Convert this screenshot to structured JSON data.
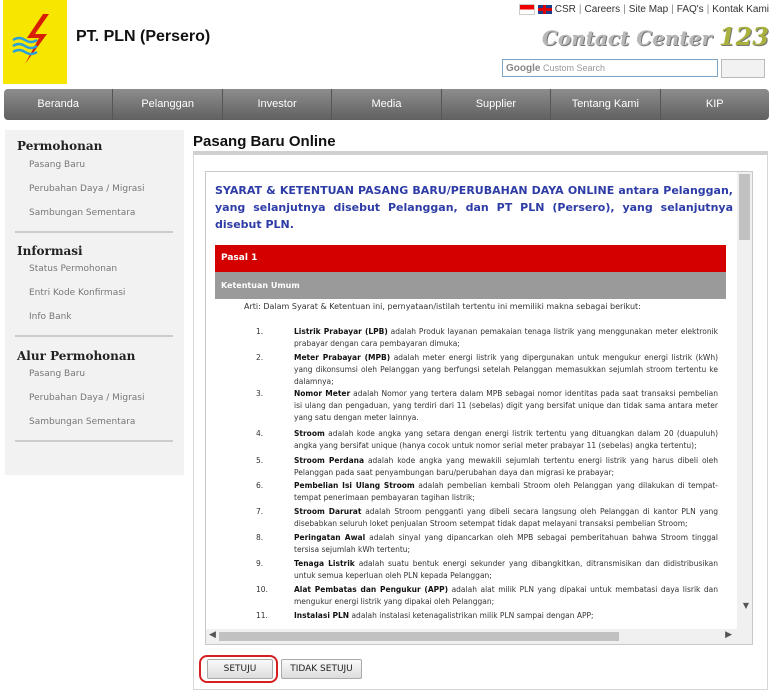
{
  "header": {
    "brand": "PT. PLN (Persero)",
    "top_links": [
      "CSR",
      "Careers",
      "Site Map",
      "FAQ's",
      "Kontak Kami"
    ],
    "contact_center_text": "Contact Center",
    "contact_center_number": "123",
    "search_google": "Google",
    "search_placeholder": "Custom Search"
  },
  "nav": [
    "Beranda",
    "Pelanggan",
    "Investor",
    "Media",
    "Supplier",
    "Tentang Kami",
    "KIP"
  ],
  "sidebar": {
    "sections": [
      {
        "title": "Permohonan",
        "items": [
          "Pasang Baru",
          "Perubahan Daya / Migrasi",
          "Sambungan Sementara"
        ]
      },
      {
        "title": "Informasi",
        "items": [
          "Status Permohonan",
          "Entri Kode Konfirmasi",
          "Info Bank"
        ]
      },
      {
        "title": "Alur Permohonan",
        "items": [
          "Pasang Baru",
          "Perubahan Daya / Migrasi",
          "Sambungan Sementara"
        ]
      }
    ]
  },
  "main": {
    "title": "Pasang Baru Online",
    "intro": "SYARAT & KETENTUAN PASANG BARU/PERUBAHAN DAYA ONLINE antara Pelanggan, yang selanjutnya disebut Pelanggan, dan PT PLN (Persero), yang selanjutnya disebut PLN.",
    "pasal": "Pasal 1",
    "section": "Ketentuan Umum",
    "arti": "Arti: Dalam Syarat & Ketentuan ini, pernyataan/istilah tertentu ini memiliki makna sebagai berikut:",
    "definitions": [
      {
        "n": "1.",
        "term": "Listrik Prabayar (LPB)",
        "text": " adalah Produk layanan pemakaian tenaga listrik yang menggunakan meter elektronik prabayar dengan cara pembayaran dimuka;"
      },
      {
        "n": "2.",
        "term": "Meter Prabayar (MPB)",
        "text": " adalah meter energi listrik yang dipergunakan untuk mengukur energi listrik (kWh) yang dikonsumsi oleh Pelanggan yang berfungsi setelah Pelanggan memasukkan sejumlah stroom tertentu ke dalamnya;"
      },
      {
        "n": "3.",
        "term": "Nomor Meter",
        "text": " adalah Nomor yang tertera dalam MPB sebagai nomor identitas pada saat transaksi pembelian isi ulang dan pengaduan, yang terdiri dari 11 (sebelas) digit yang bersifat unique dan tidak sama antara meter yang satu dengan meter lainnya."
      },
      {
        "n": "4.",
        "term": "Stroom",
        "text": " adalah kode angka yang setara dengan energi listrik tertentu yang dituangkan dalam 20 (duapuluh) angka yang bersifat unique (hanya cocok untuk nomor serial meter prabayar 11 (sebelas) angka tertentu);"
      },
      {
        "n": "5.",
        "term": "Stroom Perdana",
        "text": " adalah kode angka yang mewakili sejumlah tertentu energi listrik yang harus dibeli oleh Pelanggan pada saat penyambungan baru/perubahan daya dan migrasi ke prabayar;"
      },
      {
        "n": "6.",
        "term": "Pembelian Isi Ulang Stroom",
        "text": " adalah pembelian kembali Stroom oleh Pelanggan yang dilakukan di tempat-tempat penerimaan pembayaran tagihan listrik;"
      },
      {
        "n": "7.",
        "term": "Stroom Darurat",
        "text": " adalah Stroom pengganti yang dibeli secara langsung oleh Pelanggan di kantor PLN yang disebabkan seluruh loket penjualan Stroom setempat tidak dapat melayani transaksi pembelian Stroom;"
      },
      {
        "n": "8.",
        "term": "Peringatan Awal",
        "text": " adalah sinyal yang dipancarkan oleh MPB sebagai pemberitahuan bahwa Stroom tinggal tersisa sejumlah kWh tertentu;"
      },
      {
        "n": "9.",
        "term": "Tenaga Listrik",
        "text": " adalah suatu bentuk energi sekunder yang dibangkitkan, ditransmisikan dan didistribusikan untuk semua keperluan oleh PLN kepada Pelanggan;"
      },
      {
        "n": "10.",
        "term": "Alat Pembatas dan Pengukur (APP)",
        "text": " adalah alat milik PLN yang dipakai untuk membatasi daya lisrik dan mengukur energi listrik yang dipakai oleh Pelanggan;"
      },
      {
        "n": "11.",
        "term": "Instalasi PLN",
        "text": " adalah instalasi ketenagalistrikan milik PLN sampai dengan APP;"
      }
    ],
    "agree_label": "SETUJU",
    "disagree_label": "TIDAK SETUJU"
  }
}
